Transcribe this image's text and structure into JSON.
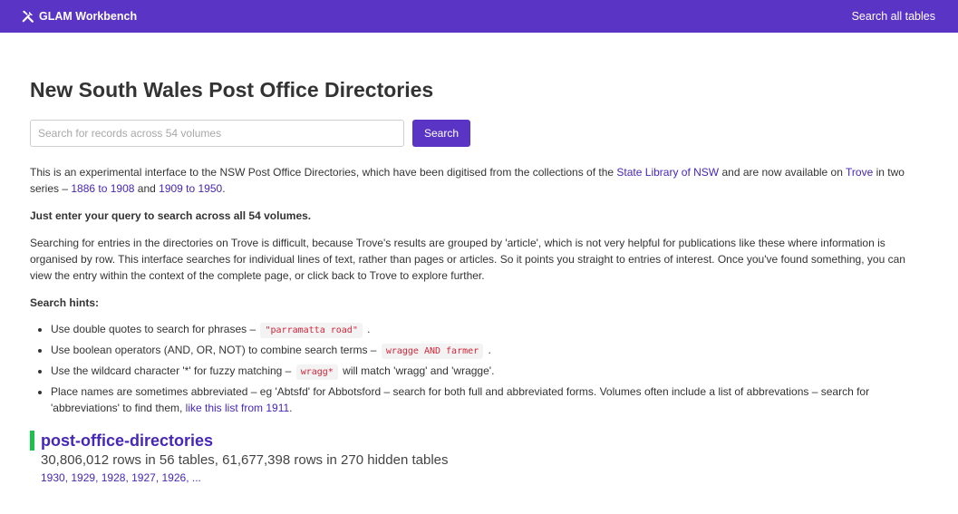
{
  "header": {
    "brand": "GLAM Workbench",
    "nav_link": "Search all tables",
    "brand_icon": "tools-icon"
  },
  "page": {
    "title": "New South Wales Post Office Directories"
  },
  "search": {
    "placeholder": "Search for records across 54 volumes",
    "value": "",
    "button_label": "Search"
  },
  "intro": {
    "t1": "This is an experimental interface to the NSW Post Office Directories, which have been digitised from the collections of the ",
    "link_sl": "State Library of NSW",
    "t2": " and are now available on ",
    "link_trove": "Trove",
    "t3": " in two series – ",
    "link_s1": "1886 to 1908",
    "t4": " and ",
    "link_s2": "1909 to 1950",
    "t5": "."
  },
  "just_enter": "Just enter your query to search across all 54 volumes.",
  "explain": "Searching for entries in the directories on Trove is difficult, because Trove's results are grouped by 'article', which is not very helpful for publications like these where information is organised by row. This interface searches for individual lines of text, rather than pages or articles. So it points you straight to entries of interest. Once you've found something, you can view the entry within the context of the complete page, or click back to Trove to explore further.",
  "hints": {
    "heading": "Search hints:",
    "h1_text": "Use double quotes to search for phrases – ",
    "h1_code": "\"parramatta road\"",
    "h1_end": " .",
    "h2_text": "Use boolean operators (AND, OR, NOT) to combine search terms – ",
    "h2_code": "wragge AND farmer",
    "h2_end": " .",
    "h3_text": "Use the wildcard character '*' for fuzzy matching – ",
    "h3_code": "wragg*",
    "h3_end": " will match 'wragg' and 'wragge'.",
    "h4_text": "Place names are sometimes abbreviated – eg 'Abtsfd' for Abbotsford – search for both full and abbreviated forms. Volumes often include a list of abbrevations – search for 'abbreviations' to find them, ",
    "h4_link": "like this list from 1911",
    "h4_end": "."
  },
  "database": {
    "name": "post-office-directories",
    "stats": "30,806,012 rows in 56 tables, 61,677,398 rows in 270 hidden tables",
    "tables": [
      "1930",
      "1929",
      "1928",
      "1927",
      "1926"
    ],
    "sep": ", ",
    "more": "..."
  },
  "colors": {
    "header_bg": "#5a34c4",
    "link": "#4627b6",
    "db_accent": "#1ec04d",
    "code_text": "#d1263a"
  }
}
